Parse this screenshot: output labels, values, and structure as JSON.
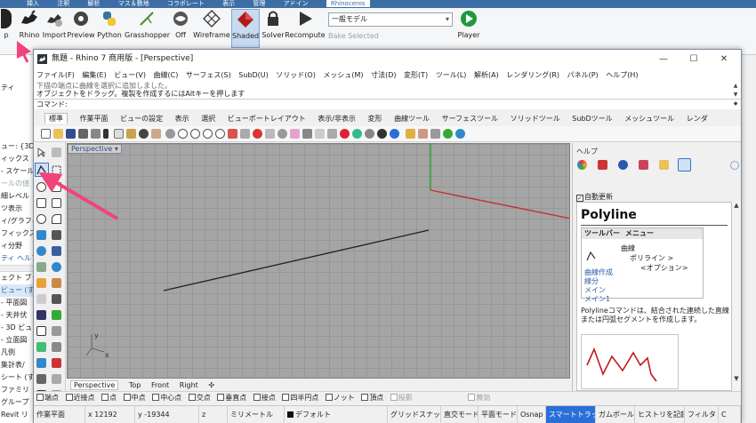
{
  "host": {
    "menu_items": [
      "挿入",
      "注釈",
      "解析",
      "マス＆敷地",
      "コラボレート",
      "表示",
      "管理",
      "アドイン"
    ],
    "active_tab": "Rhinoceros",
    "ribbon_left_label": "p",
    "buttons": [
      {
        "id": "rhino",
        "label": "Rhino"
      },
      {
        "id": "import",
        "label": "Import"
      },
      {
        "id": "preview",
        "label": "Preview"
      },
      {
        "id": "python",
        "label": "Python"
      },
      {
        "id": "grasshopper",
        "label": "Grasshopper"
      },
      {
        "id": "off",
        "label": "Off"
      },
      {
        "id": "wireframe",
        "label": "Wireframe"
      },
      {
        "id": "shaded",
        "label": "Shaded"
      },
      {
        "id": "solver",
        "label": "Solver"
      },
      {
        "id": "recompute",
        "label": "Recompute"
      },
      {
        "id": "player",
        "label": "Player"
      }
    ],
    "combo_value": "一般モデル",
    "bake_label": "Bake Selected",
    "left_panel_rows": [
      {
        "text": "ティ",
        "style": "normal"
      },
      {
        "text": "ュー: {3D}",
        "style": "normal"
      },
      {
        "text": "ィックス",
        "style": "normal"
      },
      {
        "text": "- スケール",
        "style": "normal"
      },
      {
        "text": "ールの値",
        "style": "dim"
      },
      {
        "text": "細レベル",
        "style": "normal"
      },
      {
        "text": "ツ表示",
        "style": "normal"
      },
      {
        "text": "ィ/グラフィ…",
        "style": "normal"
      },
      {
        "text": "フィックス…",
        "style": "normal"
      },
      {
        "text": "ィ分野",
        "style": "normal"
      },
      {
        "text": "ティ ヘルプ",
        "style": "link"
      },
      {
        "text": "ェクト ブラウ",
        "style": "normal"
      },
      {
        "text": "ビュー (す",
        "style": "sel"
      },
      {
        "text": "- 平面図",
        "style": "normal"
      },
      {
        "text": "- 天井伏",
        "style": "normal"
      },
      {
        "text": "- 3D ビュ",
        "style": "normal"
      },
      {
        "text": "- 立面図",
        "style": "normal"
      },
      {
        "text": "凡例",
        "style": "normal"
      },
      {
        "text": "集計表/",
        "style": "normal"
      },
      {
        "text": "シート (す",
        "style": "normal"
      },
      {
        "text": "ファミリ",
        "style": "normal"
      },
      {
        "text": "グループ",
        "style": "normal"
      },
      {
        "text": "Revit リ",
        "style": "normal"
      }
    ]
  },
  "rhino": {
    "title": "無題 - Rhino 7 商用版 - [Perspective]",
    "window_buttons": [
      "—",
      "☐",
      "✕"
    ],
    "menu": [
      "ファイル(F)",
      "編集(E)",
      "ビュー(V)",
      "曲線(C)",
      "サーフェス(S)",
      "SubD(U)",
      "ソリッド(O)",
      "メッシュ(M)",
      "寸法(D)",
      "変形(T)",
      "ツール(L)",
      "解析(A)",
      "レンダリング(R)",
      "パネル(P)",
      "ヘルプ(H)"
    ],
    "history_line1": "下描の端点に曲線を選択に追加しました。",
    "history_line2": "オブジェクトをドラッグ。複製を作成するにはAltキーを押します",
    "command_prompt": "コマンド:",
    "toolbar_tabs": [
      "標準",
      "作業平面",
      "ビューの設定",
      "表示",
      "選択",
      "ビューポートレイアウト",
      "表示/非表示",
      "変形",
      "曲線ツール",
      "サーフェスツール",
      "ソリッドツール",
      "SubDツール",
      "メッシュツール",
      "レンダ"
    ],
    "active_tab_index": 0,
    "viewport_label": "Perspective",
    "axis_labels": {
      "y": "y",
      "x": "x",
      "z": "z"
    },
    "view_tabs": [
      "Perspective",
      "Top",
      "Front",
      "Right",
      "✣"
    ],
    "osnaps": [
      {
        "label": "端点",
        "checked": false
      },
      {
        "label": "近接点",
        "checked": false
      },
      {
        "label": "点",
        "checked": false
      },
      {
        "label": "中点",
        "checked": false
      },
      {
        "label": "中心点",
        "checked": false
      },
      {
        "label": "交点",
        "checked": false
      },
      {
        "label": "垂直点",
        "checked": false
      },
      {
        "label": "接点",
        "checked": false
      },
      {
        "label": "四半円点",
        "checked": false
      },
      {
        "label": "ノット",
        "checked": false
      },
      {
        "label": "頂点",
        "checked": false
      },
      {
        "label": "投影",
        "checked": false,
        "gray": true
      },
      {
        "label": "無効",
        "checked": false,
        "gray": true
      }
    ],
    "status": {
      "cplane": "作業平面",
      "x": "x 12192",
      "y": "y -19344",
      "z": "z",
      "units": "ミリメートル",
      "layer": "デフォルト",
      "grid_snap": "グリッドスナップ",
      "ortho": "直交モード",
      "planar": "平面モード",
      "osnap": "Osnap",
      "smarttrack": "スマートトラック",
      "gumball": "ガムボール",
      "history": "ヒストリを記録",
      "filter": "フィルタ",
      "cpu": "C"
    }
  },
  "panel": {
    "title": "ヘルプ",
    "auto_update": "自動更新",
    "auto_update_checked": true,
    "heading": "Polyline",
    "table_header_toolbar": "ツールバー",
    "table_header_menu": "メニュー",
    "menu_path": [
      "曲線",
      "ポリライン >",
      "<オプション>"
    ],
    "toolbar_links": [
      "曲線作成",
      "線分",
      "メイン",
      "メイン1"
    ],
    "description": "Polylineコマンドは、結合された連続した直線または円弧セグメントを作成します。"
  },
  "colors": {
    "annotation_arrow": "#f0447a",
    "viewport_bg": "#a5a5a5",
    "x_axis": "#c43030",
    "y_axis": "#2fa02f",
    "selected_blue": "#2a6fd8",
    "help_sketch": "#c41a1a"
  }
}
